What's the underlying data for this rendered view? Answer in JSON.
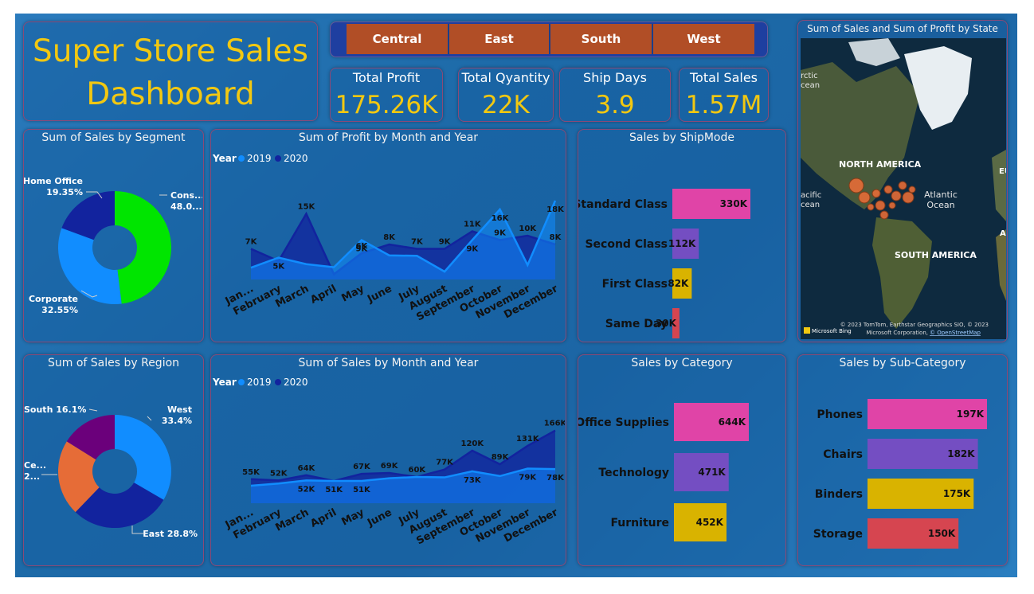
{
  "title": {
    "line1": "Super Store Sales",
    "line2": "Dashboard"
  },
  "slicer": {
    "items": [
      "Central",
      "East",
      "South",
      "West"
    ]
  },
  "kpis": [
    {
      "label": "Total Profit",
      "value": "175.26K"
    },
    {
      "label": "Total Qyantity",
      "value": "22K"
    },
    {
      "label": "Ship Days",
      "value": "3.9"
    },
    {
      "label": "Total Sales",
      "value": "1.57M"
    }
  ],
  "map": {
    "title": "Sum of Sales and Sum of Profit by State",
    "labels": {
      "na": "NORTH AMERICA",
      "sa": "SOUTH AMERICA",
      "atl1": "Atlantic",
      "atl2": "Ocean",
      "arc1": "rctic",
      "arc2": "cean",
      "pac1": "acific",
      "pac2": "cean",
      "eu": "EU",
      "a": "A"
    },
    "credits": {
      "line1": "© 2023 TomTom, Earthstar Geographics SIO, © 2023",
      "line2": "Microsoft Corporation,",
      "link": "© OpenStreetMap",
      "bing": "Microsoft Bing"
    }
  },
  "colors": {
    "y2019": "#118dff",
    "y2020": "#12239e",
    "pink": "#e044a7",
    "purple": "#744ec2",
    "yellow": "#d9b300",
    "red": "#d64550",
    "green": "#00e500",
    "orange": "#e66c37",
    "dpurple": "#6b007b",
    "gold": "#f2c811"
  },
  "chart_data": [
    {
      "type": "pie",
      "title": "Sum of Sales by Segment",
      "categories": [
        "Consumer",
        "Corporate",
        "Home Office"
      ],
      "values": [
        48.0,
        32.55,
        19.35
      ],
      "labels": [
        {
          "name": "Cons...",
          "pct": "48.0..."
        },
        {
          "name": "Corporate",
          "pct": "32.55%"
        },
        {
          "name": "Home Office",
          "pct": "19.35%"
        }
      ]
    },
    {
      "type": "area",
      "title": "Sum of Profit by Month and Year",
      "legend_title": "Year",
      "categories": [
        "Jan...",
        "February",
        "March",
        "April",
        "May",
        "June",
        "July",
        "August",
        "September",
        "October",
        "November",
        "December"
      ],
      "series": [
        {
          "name": "2019",
          "values": [
            2.7,
            5,
            3.5,
            2.8,
            9,
            5.5,
            5.4,
            1.8,
            9,
            16,
            3.3,
            18
          ]
        },
        {
          "name": "2020",
          "values": [
            7,
            4.2,
            15,
            1.2,
            6,
            8,
            7,
            7,
            11,
            9,
            10,
            8
          ]
        }
      ],
      "labels2019": [
        "",
        "5K",
        "",
        "",
        "9K",
        "",
        "",
        "",
        "9K",
        "16K",
        "",
        "18K"
      ],
      "labels2020": [
        "7K",
        "",
        "15K",
        "",
        "6K",
        "8K",
        "7K",
        "9K",
        "11K",
        "9K",
        "10K",
        "8K"
      ]
    },
    {
      "type": "bar",
      "title": "Sales by ShipMode",
      "categories": [
        "Standard Class",
        "Second Class",
        "First Class",
        "Same Day"
      ],
      "values": [
        330,
        112,
        82,
        30
      ],
      "labels": [
        "330K",
        "112K",
        "82K",
        "30K"
      ]
    },
    {
      "type": "pie",
      "title": "Sum of Sales by Region",
      "categories": [
        "West",
        "East",
        "Central",
        "South"
      ],
      "values": [
        33.4,
        28.8,
        21.7,
        16.1
      ],
      "labels": [
        {
          "name": "West",
          "pct": "33.4%"
        },
        {
          "name": "East 28.8%",
          "pct": ""
        },
        {
          "name": "Ce...",
          "pct": "2..."
        },
        {
          "name": "South 16.1%",
          "pct": ""
        }
      ]
    },
    {
      "type": "area",
      "title": "Sum of Sales by Month and Year",
      "legend_title": "Year",
      "categories": [
        "Jan...",
        "February",
        "March",
        "April",
        "May",
        "June",
        "July",
        "August",
        "September",
        "October",
        "November",
        "December"
      ],
      "series": [
        {
          "name": "2019",
          "values": [
            40,
            45,
            52,
            51,
            51,
            57,
            60,
            59,
            73,
            62,
            79,
            78
          ]
        },
        {
          "name": "2020",
          "values": [
            55,
            52,
            64,
            51,
            67,
            69,
            60,
            77,
            120,
            89,
            131,
            166
          ]
        }
      ],
      "labels2019": [
        "",
        "",
        "52K",
        "51K",
        "51K",
        "",
        "",
        "",
        "73K",
        "",
        "79K",
        "78K"
      ],
      "labels2020": [
        "55K",
        "52K",
        "64K",
        "",
        "67K",
        "69K",
        "60K",
        "77K",
        "120K",
        "89K",
        "131K",
        "166K"
      ]
    },
    {
      "type": "bar",
      "title": "Sales by Category",
      "categories": [
        "Office Supplies",
        "Technology",
        "Furniture"
      ],
      "values": [
        644,
        471,
        452
      ],
      "labels": [
        "644K",
        "471K",
        "452K"
      ]
    },
    {
      "type": "bar",
      "title": "Sales by Sub-Category",
      "categories": [
        "Phones",
        "Chairs",
        "Binders",
        "Storage"
      ],
      "values": [
        197,
        182,
        175,
        150
      ],
      "labels": [
        "197K",
        "182K",
        "175K",
        "150K"
      ]
    }
  ]
}
